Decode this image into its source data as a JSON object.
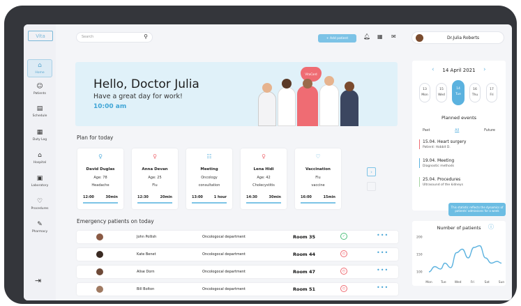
{
  "app": {
    "logo": "Vita"
  },
  "sidebar": {
    "items": [
      {
        "label": "Home",
        "icon": "home-icon",
        "glyph": "⌂"
      },
      {
        "label": "Patients",
        "icon": "patients-icon",
        "glyph": "☺"
      },
      {
        "label": "Schedule",
        "icon": "schedule-icon",
        "glyph": "▤"
      },
      {
        "label": "Duty Log",
        "icon": "duty-log-icon",
        "glyph": "▦"
      },
      {
        "label": "Hospital",
        "icon": "hospital-icon",
        "glyph": "⌂"
      },
      {
        "label": "Laboratory",
        "icon": "laboratory-icon",
        "glyph": "▣"
      },
      {
        "label": "Procedures",
        "icon": "procedures-icon",
        "glyph": "♡"
      },
      {
        "label": "Pharmacy",
        "icon": "pharmacy-icon",
        "glyph": "✎"
      }
    ],
    "logout_glyph": "⇥"
  },
  "header": {
    "search_placeholder": "Search",
    "add_patient": "+ Add patient",
    "user_name": "Dr.Julia Roberts"
  },
  "hero": {
    "greeting": "Hello, Doctor Julia",
    "subtitle": "Have a great day for work!",
    "time": "10:00 am",
    "badge": "VitaCard"
  },
  "plan": {
    "title": "Plan for today",
    "cards": [
      {
        "name": "David Duglas",
        "line2": "Age:     78",
        "line3": "Headache",
        "start": "12:00",
        "dur": "30min",
        "color": "#5bb2df",
        "glyph": "♀"
      },
      {
        "name": "Anna Devan",
        "line2": "Age:     25",
        "line3": "Flu",
        "start": "12:30",
        "dur": "20min",
        "color": "#ef6c73",
        "glyph": "♀"
      },
      {
        "name": "Meeting",
        "line2": "Oncology",
        "line3": "consultation",
        "start": "13:00",
        "dur": "1 hour",
        "color": "#5bb2df",
        "glyph": "☷"
      },
      {
        "name": "Lena Hidi",
        "line2": "Age:     42",
        "line3": "Cholecystitis",
        "start": "14:30",
        "dur": "30min",
        "color": "#ef6c73",
        "glyph": "♀"
      },
      {
        "name": "Vaccination",
        "line2": "Flu",
        "line3": "vaccine",
        "start": "16:00",
        "dur": "15min",
        "color": "#5bb2df",
        "glyph": "♡"
      }
    ],
    "next_glyph": "›"
  },
  "emergency": {
    "title": "Emergency patients on today",
    "rows": [
      {
        "name": "John Pollish",
        "dept": "Oncologocal department",
        "room": "Room 35",
        "status": "✓",
        "status_color": "#4cbf7a"
      },
      {
        "name": "Kate Benet",
        "dept": "Oncologocal department",
        "room": "Room 44",
        "status": "◴",
        "status_color": "#ef6c73"
      },
      {
        "name": "Alise Dorn",
        "dept": "Oncologocal department",
        "room": "Room 47",
        "status": "◴",
        "status_color": "#ef6c73"
      },
      {
        "name": "Bill Bolton",
        "dept": "Oncologocal department",
        "room": "Room 51",
        "status": "◴",
        "status_color": "#ef6c73"
      }
    ],
    "more": "•••"
  },
  "calendar": {
    "date": "14 April 2021",
    "days": [
      {
        "num": "13",
        "name": "Mon"
      },
      {
        "num": "15",
        "name": "Wed"
      },
      {
        "num": "14",
        "name": "Tue"
      },
      {
        "num": "16",
        "name": "Thu"
      },
      {
        "num": "17",
        "name": "Fri"
      }
    ]
  },
  "events": {
    "title": "Planned events",
    "tabs": [
      "Past",
      "All",
      "Future"
    ],
    "items": [
      {
        "date_title": "15.04. Heart surgery",
        "detail": "Patient: Hobbit D.",
        "color": "#ef6c73"
      },
      {
        "date_title": "19.04. Meeting",
        "detail": "Diagnostic methods",
        "color": "#5bb2df"
      },
      {
        "date_title": "25.04. Procedures",
        "detail": "Ultrasound of the kidneys",
        "color": "#a6d4a3"
      }
    ]
  },
  "patients_chart": {
    "tooltip": "This statistic reflects the dynamics of patients' admissions for a week",
    "info_glyph": "ⓘ"
  },
  "chart_data": {
    "type": "line",
    "title": "Number of patients",
    "categories": [
      "Mon",
      "Tue",
      "Wed",
      "Fri",
      "Sat",
      "Sun"
    ],
    "y_ticks": [
      100,
      150,
      200
    ],
    "ylim": [
      90,
      210
    ],
    "x_points": [
      0,
      0.4,
      0.8,
      1.1,
      1.5,
      1.9,
      2.3,
      2.7,
      3.1,
      3.5,
      3.9,
      4.3,
      4.7,
      5.0
    ],
    "values": [
      100,
      115,
      108,
      125,
      112,
      155,
      165,
      140,
      170,
      175,
      140,
      125,
      130,
      125
    ],
    "color": "#5bb2df"
  }
}
